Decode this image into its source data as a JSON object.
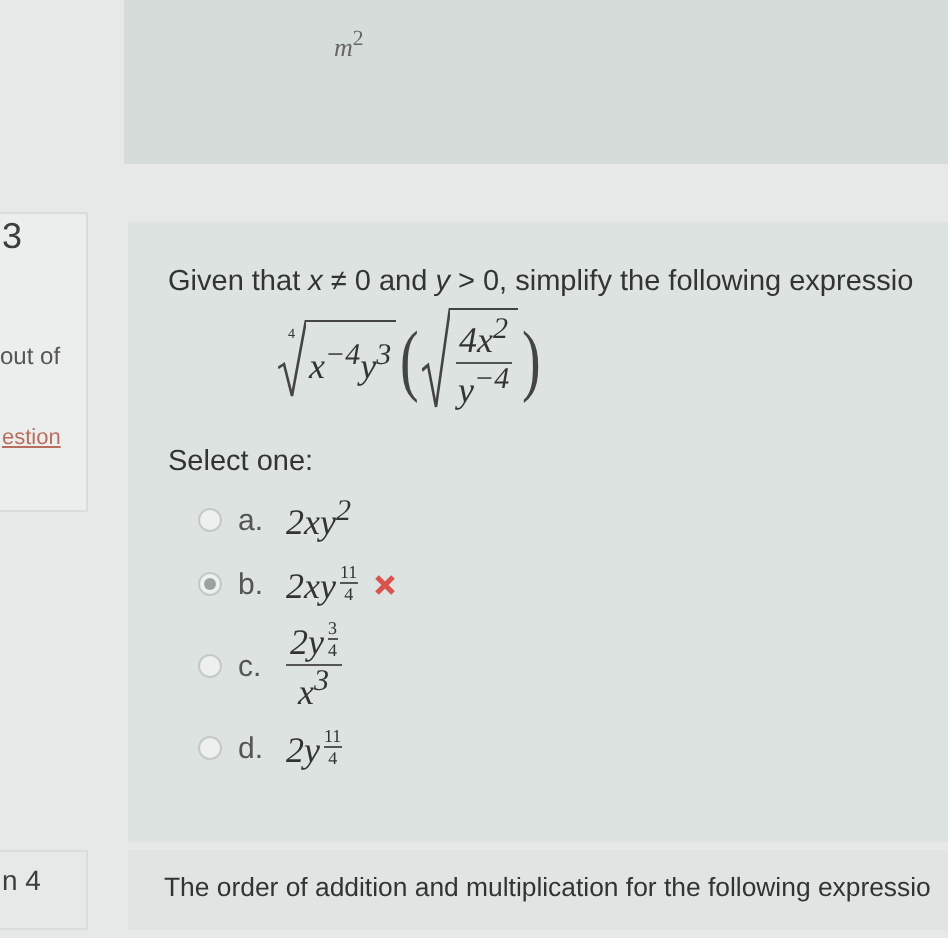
{
  "previous_panel": {
    "text": "*m*$^{2}$"
  },
  "question": {
    "number": "3",
    "marks": "out of",
    "flag_link": "estion",
    "prompt": "Given that *x* ≠ 0 and *y* > 0, simplify the following expressio",
    "expression": {
      "root_index": "4",
      "radicand": "x$^{−4}$y$^{3}$",
      "open_paren": "(",
      "inner_numerator": "4x$^{2}$",
      "inner_denominator": "y$^{−4}$",
      "close_paren": ")"
    },
    "select_label": "Select one:",
    "options": [
      {
        "letter": "a.",
        "kind": "power",
        "base": "2xy",
        "exponent": "2",
        "selected": false,
        "incorrect": false
      },
      {
        "letter": "b.",
        "kind": "fraction_power",
        "base": "2xy",
        "exp_num": "11",
        "exp_den": "4",
        "selected": true,
        "incorrect": true
      },
      {
        "letter": "c.",
        "kind": "quotient",
        "base": "2y",
        "exp_num": "3",
        "exp_den": "4",
        "denominator": "x$^{3}$",
        "selected": false,
        "incorrect": false
      },
      {
        "letter": "d.",
        "kind": "fraction_power",
        "base": "2y",
        "exp_num": "11",
        "exp_den": "4",
        "selected": false,
        "incorrect": false
      }
    ]
  },
  "next_question": {
    "number": "n 4",
    "prompt": "The order of addition and multiplication for the following expressio"
  }
}
